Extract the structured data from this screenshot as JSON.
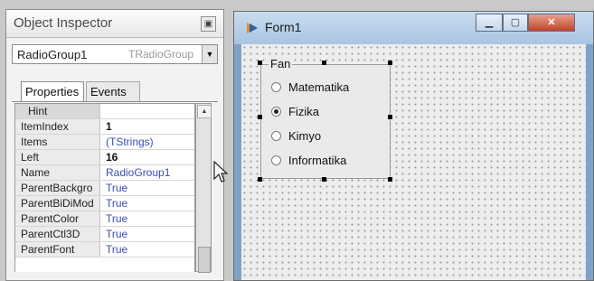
{
  "inspector": {
    "title": "Object Inspector",
    "pin_icon": "pin-icon",
    "component": "RadioGroup1",
    "component_class": "TRadioGroup",
    "tabs": [
      "Properties",
      "Events"
    ],
    "rows": [
      {
        "key": "Hint",
        "value": ""
      },
      {
        "key": "ItemIndex",
        "value": "1"
      },
      {
        "key": "Items",
        "value": "(TStrings)"
      },
      {
        "key": "Left",
        "value": "16"
      },
      {
        "key": "Name",
        "value": "RadioGroup1"
      },
      {
        "key": "ParentBackgro",
        "value": "True"
      },
      {
        "key": "ParentBiDiMod",
        "value": "True"
      },
      {
        "key": "ParentColor",
        "value": "True"
      },
      {
        "key": "ParentCtl3D",
        "value": "True"
      },
      {
        "key": "ParentFont",
        "value": "True"
      }
    ]
  },
  "form": {
    "title": "Form1",
    "radiogroup": {
      "caption": "Fan",
      "items": [
        "Matematika",
        "Fizika",
        "Kimyo",
        "Informatika"
      ],
      "selected_index": 1
    }
  },
  "colors": {
    "value_blue": "#3a4fb5",
    "close_button": "#c0442b"
  }
}
